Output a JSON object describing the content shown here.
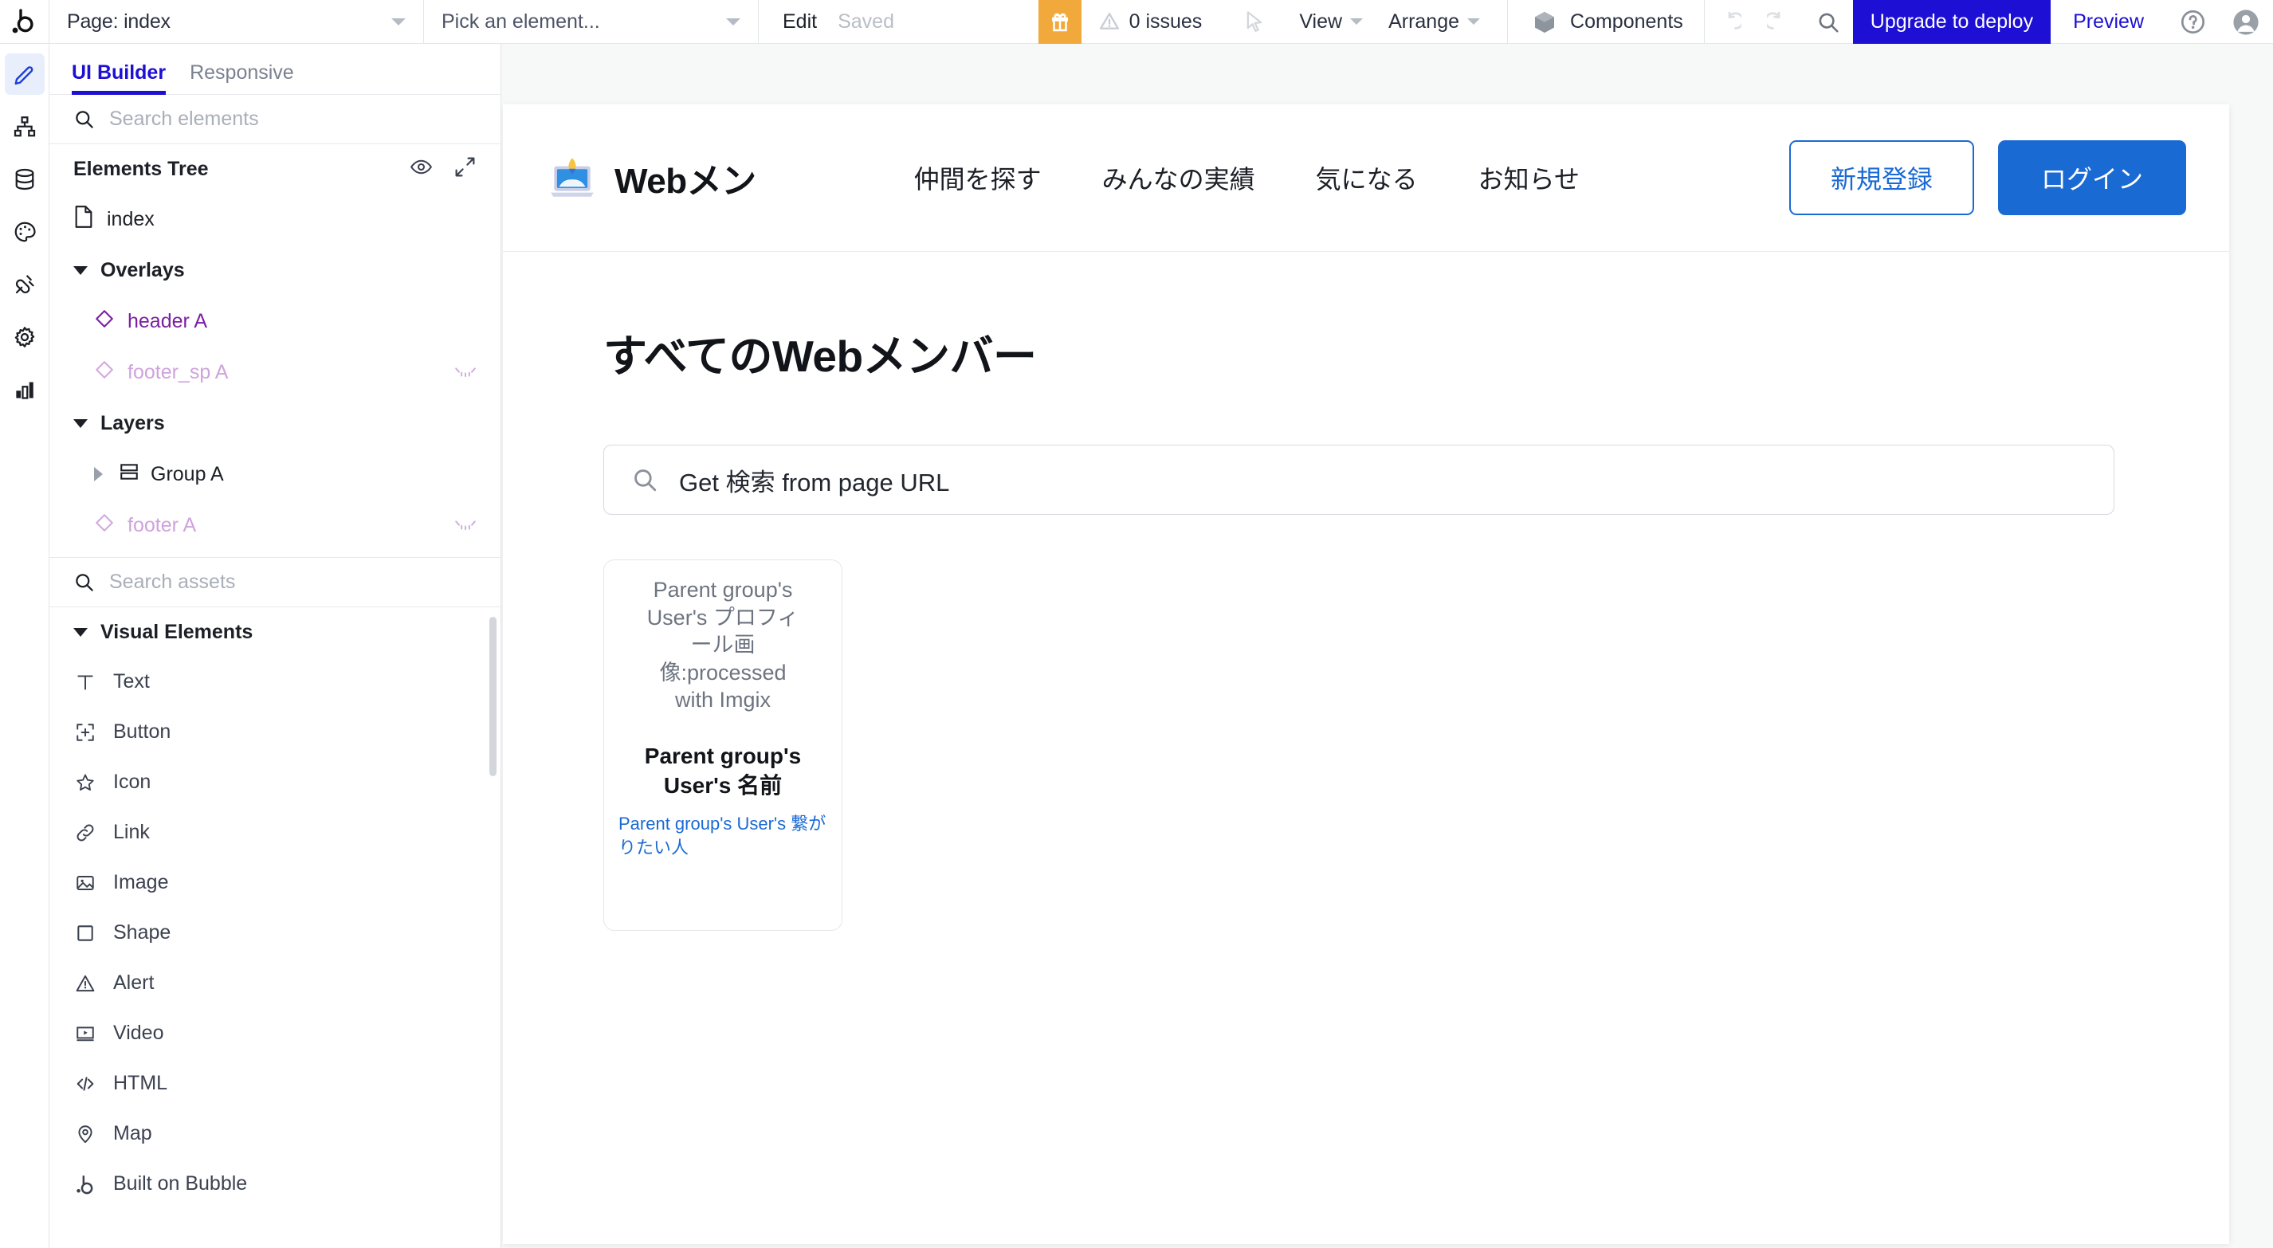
{
  "topbar": {
    "logo_icon": "bubble-logo-icon",
    "page_select": {
      "label": "Page: index",
      "caret_icon": "chevron-down-icon"
    },
    "element_select": {
      "label": "Pick an element...",
      "caret_icon": "chevron-down-icon"
    },
    "edit_label": "Edit",
    "saved_label": "Saved",
    "gift_icon": "gift-icon",
    "issues": {
      "icon": "warning-triangle-icon",
      "label": "0 issues"
    },
    "cursor_icon": "cursor-arrow-icon",
    "view_menu": {
      "label": "View",
      "caret_icon": "chevron-down-icon"
    },
    "arrange_menu": {
      "label": "Arrange",
      "caret_icon": "chevron-down-icon"
    },
    "components": {
      "icon": "cube-icon",
      "label": "Components"
    },
    "undo_icon": "undo-icon",
    "redo_icon": "redo-icon",
    "search_icon": "search-icon",
    "upgrade_label": "Upgrade to deploy",
    "preview_label": "Preview",
    "help_icon": "question-circle-icon",
    "avatar_icon": "user-avatar-icon",
    "accent_blue": "#1d0fd4",
    "gift_orange": "#f2a93b"
  },
  "rail": {
    "items": [
      {
        "icon": "pencil-design-icon",
        "active": true
      },
      {
        "icon": "workflow-sitemap-icon",
        "active": false
      },
      {
        "icon": "database-icon",
        "active": false
      },
      {
        "icon": "palette-styles-icon",
        "active": false
      },
      {
        "icon": "plug-plugins-icon",
        "active": false
      },
      {
        "icon": "gear-settings-icon",
        "active": false
      },
      {
        "icon": "bar-chart-logs-icon",
        "active": false
      }
    ]
  },
  "panel": {
    "tabs": [
      {
        "label": "UI Builder",
        "active": true
      },
      {
        "label": "Responsive",
        "active": false
      }
    ],
    "element_search": {
      "icon": "search-icon",
      "placeholder": "Search elements"
    },
    "tree_header": {
      "title": "Elements Tree",
      "eye_icon": "eye-icon",
      "expand_icon": "expand-diagonal-icon"
    },
    "tree": [
      {
        "label": "index",
        "icon": "page-file-icon",
        "indent": 0,
        "style": "normal",
        "hidden": false
      },
      {
        "label": "Overlays",
        "icon": "triangle-down-icon",
        "indent": 0,
        "style": "bold",
        "hidden": false
      },
      {
        "label": "header A",
        "icon": "diamond-reusable-icon",
        "indent": 1,
        "style": "purple",
        "hidden": false
      },
      {
        "label": "footer_sp A",
        "icon": "diamond-reusable-icon",
        "indent": 1,
        "style": "purple-dim",
        "hidden": true
      },
      {
        "label": "Layers",
        "icon": "triangle-down-icon",
        "indent": 0,
        "style": "bold",
        "hidden": false
      },
      {
        "label": "Group A",
        "icon": "group-rows-icon",
        "indent": 1,
        "style": "normal",
        "hidden": false
      },
      {
        "label": "footer A",
        "icon": "diamond-reusable-icon",
        "indent": 1,
        "style": "purple-dim",
        "hidden": true
      }
    ],
    "asset_search": {
      "icon": "search-icon",
      "placeholder": "Search assets"
    },
    "assets_section": {
      "label": "Visual Elements",
      "caret_icon": "triangle-down-icon"
    },
    "assets": [
      {
        "label": "Text",
        "icon": "text-t-icon"
      },
      {
        "label": "Button",
        "icon": "button-plus-icon"
      },
      {
        "label": "Icon",
        "icon": "star-icon"
      },
      {
        "label": "Link",
        "icon": "link-chain-icon"
      },
      {
        "label": "Image",
        "icon": "image-picture-icon"
      },
      {
        "label": "Shape",
        "icon": "shape-square-icon"
      },
      {
        "label": "Alert",
        "icon": "alert-triangle-icon"
      },
      {
        "label": "Video",
        "icon": "video-play-icon"
      },
      {
        "label": "HTML",
        "icon": "code-html-icon"
      },
      {
        "label": "Map",
        "icon": "map-pin-icon"
      },
      {
        "label": "Built on Bubble",
        "icon": "bubble-b-icon"
      }
    ]
  },
  "canvas": {
    "site_header": {
      "logo_icon": "laptop-rocket-logo-icon",
      "brand_name": "Webメン",
      "nav": [
        {
          "label": "仲間を探す"
        },
        {
          "label": "みんなの実績"
        },
        {
          "label": "気になる"
        },
        {
          "label": "お知らせ"
        }
      ],
      "signup_label": "新規登録",
      "login_label": "ログイン",
      "primary_blue": "#1a6ad4"
    },
    "page_title": "すべてのWebメンバー",
    "search": {
      "icon": "search-icon",
      "value": "Get 検索 from page URL"
    },
    "cards": [
      {
        "image_placeholder": "Parent group's User's プロフィール画像:processed with Imgix",
        "name": "Parent group's User's 名前",
        "link": "Parent group's User's 繋がりたい人"
      }
    ]
  }
}
